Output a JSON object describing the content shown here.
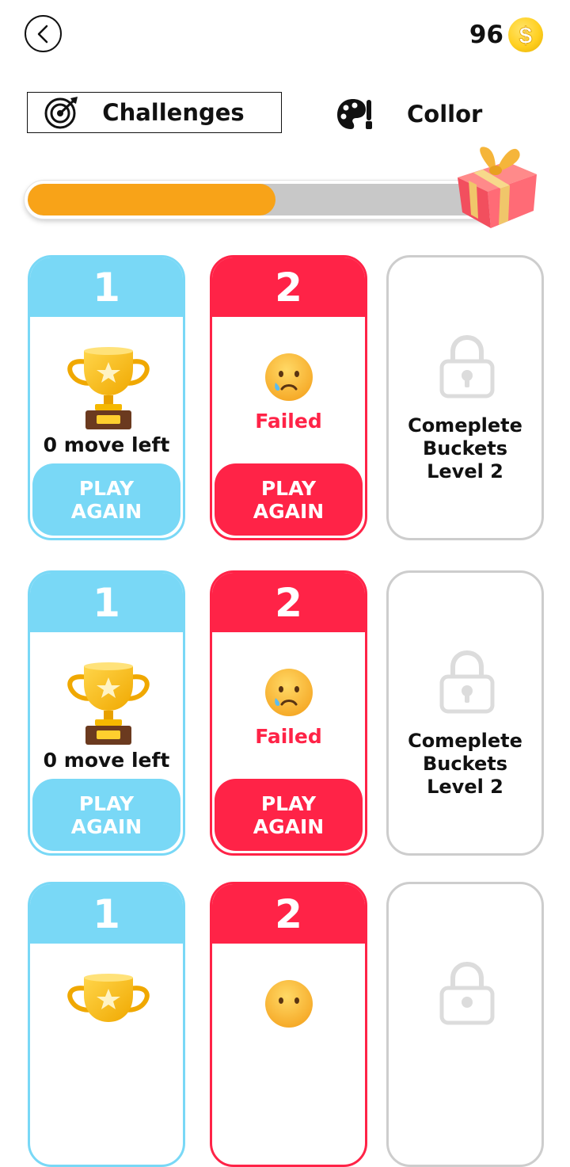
{
  "header": {
    "coins": "96",
    "back_icon": "chevron-left-icon",
    "coin_icon": "dollar-coin-icon"
  },
  "tabs": [
    {
      "label": "Challenges",
      "icon": "target-icon",
      "selected": true
    },
    {
      "label": "Collor",
      "icon": "palette-icon",
      "selected": false
    }
  ],
  "progress": {
    "value": 0.52,
    "fill_color": "#f8a318",
    "reward_icon": "gift-box-icon"
  },
  "colors": {
    "blue": "#79d8f6",
    "red": "#ff2347",
    "locked_border": "#cdcdcd"
  },
  "rows": [
    {
      "won": {
        "number": "1",
        "moves": "0 move left",
        "button_line1": "PLAY",
        "button_line2": "AGAIN"
      },
      "failed": {
        "number": "2",
        "status": "Failed",
        "button_line1": "PLAY",
        "button_line2": "AGAIN"
      },
      "locked": {
        "line1": "Comeplete",
        "line2": "Buckets",
        "line3": "Level 2"
      }
    },
    {
      "won": {
        "number": "1",
        "moves": "0 move left",
        "button_line1": "PLAY",
        "button_line2": "AGAIN"
      },
      "failed": {
        "number": "2",
        "status": "Failed",
        "button_line1": "PLAY",
        "button_line2": "AGAIN"
      },
      "locked": {
        "line1": "Comeplete",
        "line2": "Buckets",
        "line3": "Level 2"
      }
    },
    {
      "won": {
        "number": "1"
      },
      "failed": {
        "number": "2"
      },
      "locked": {}
    }
  ]
}
